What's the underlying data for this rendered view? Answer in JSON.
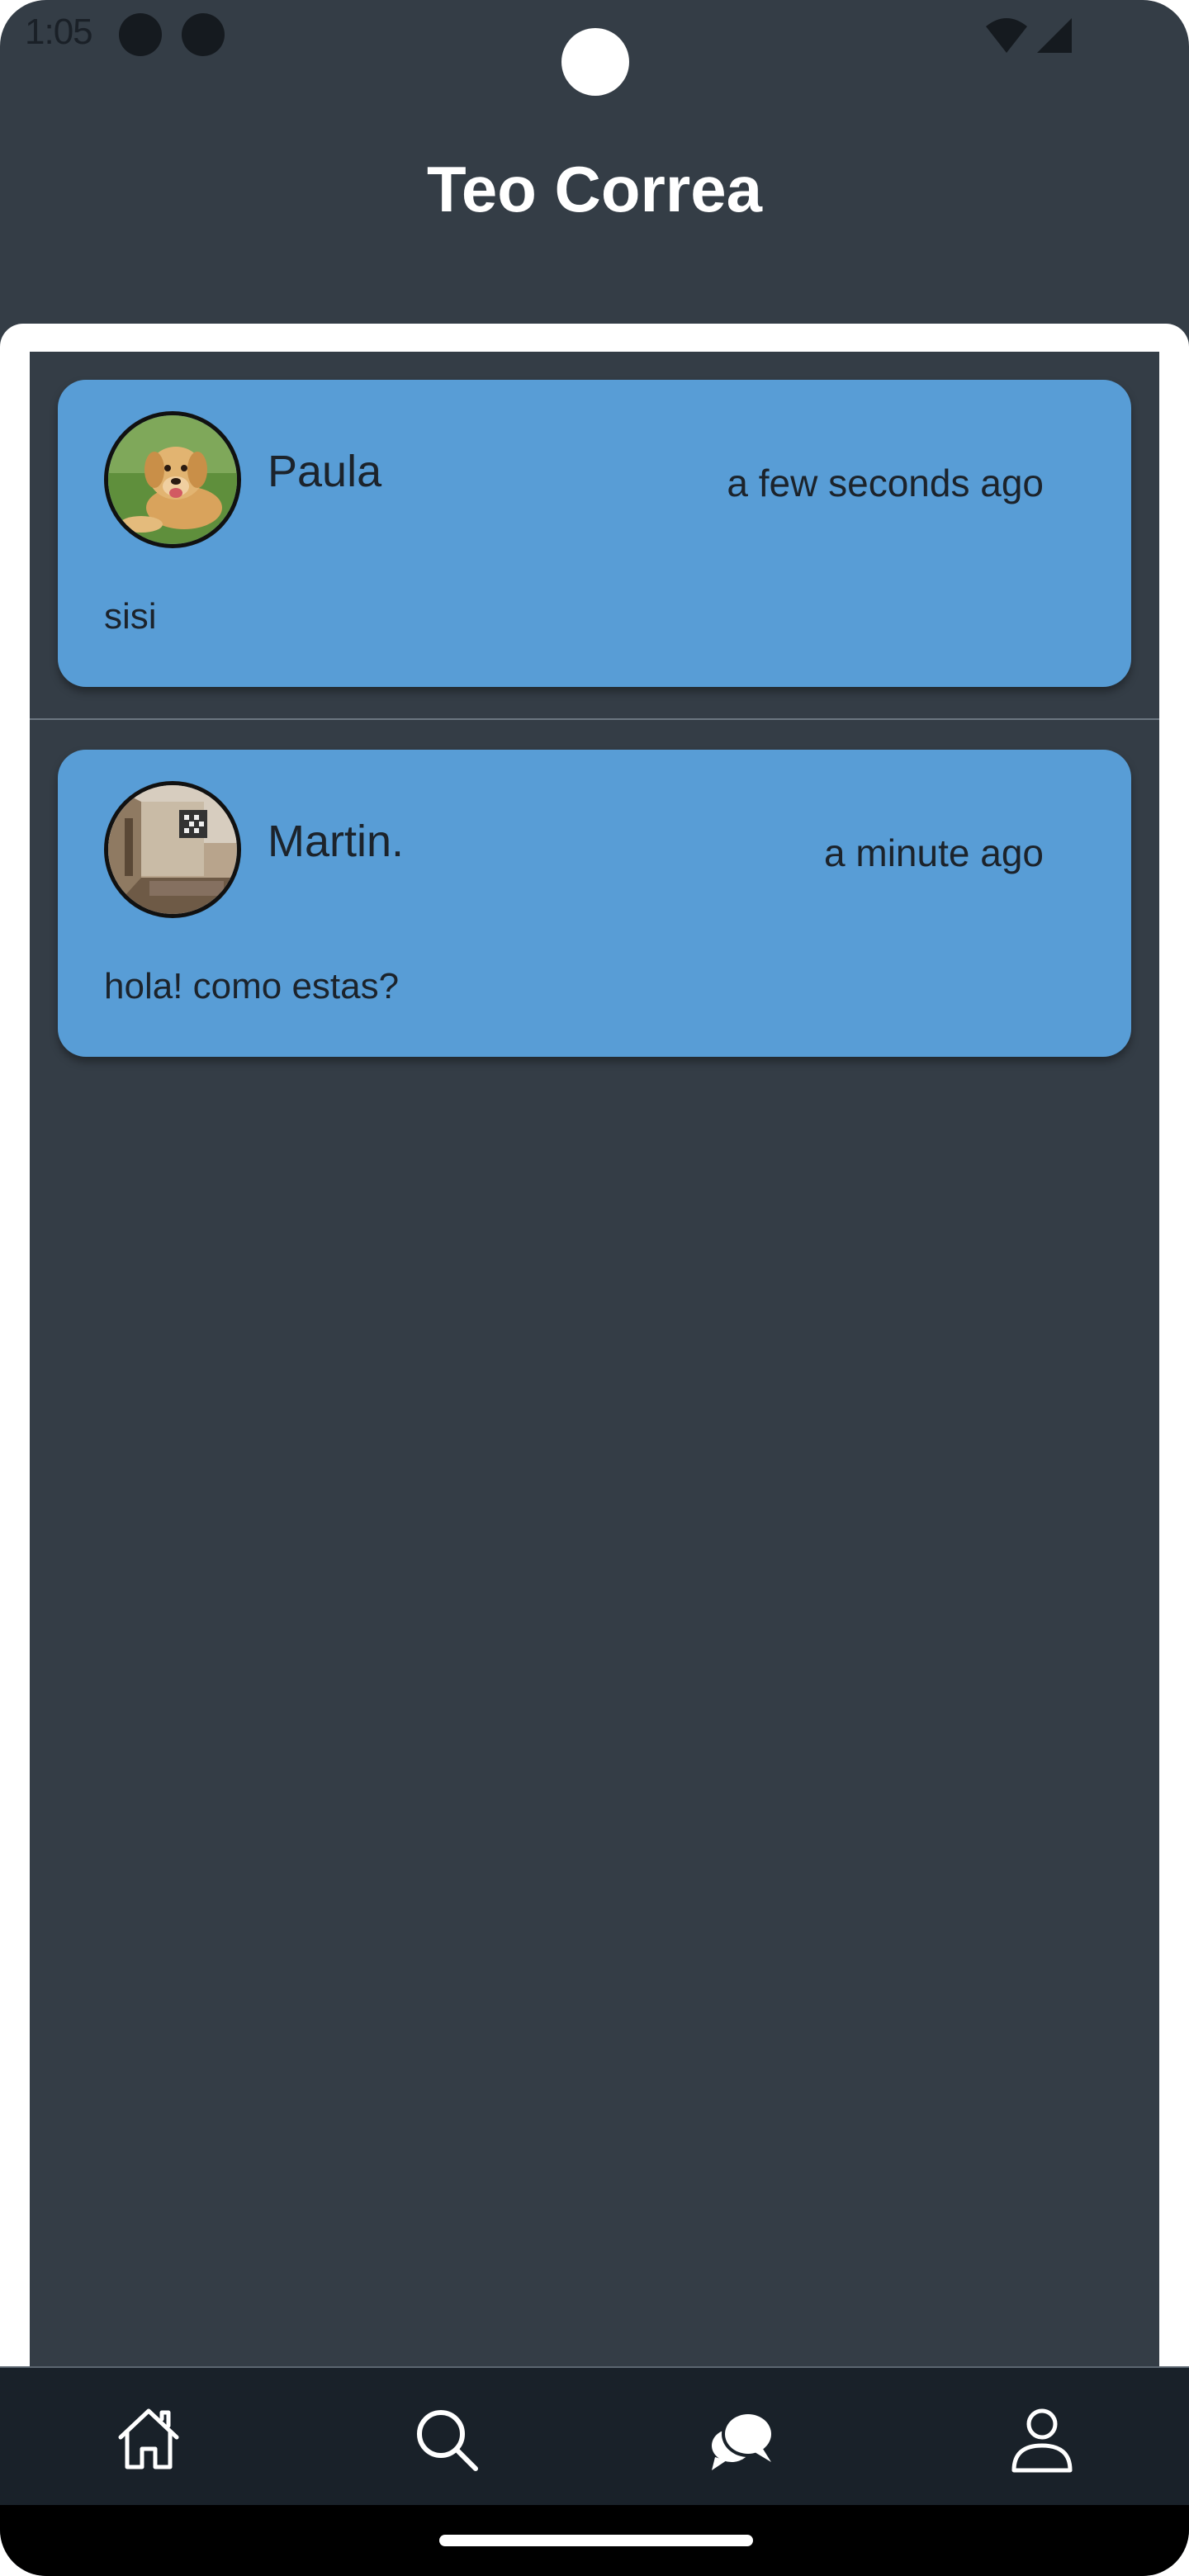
{
  "status_bar": {
    "time": "1:05"
  },
  "header": {
    "title": "Teo Correa"
  },
  "chats": [
    {
      "name": "Paula",
      "time": "a few seconds ago",
      "message": "sisi",
      "avatar": "dog-photo"
    },
    {
      "name": "Martin.",
      "time": "a minute ago",
      "message": "hola! como estas?",
      "avatar": "room-photo"
    }
  ],
  "bottom_nav": {
    "items": [
      {
        "icon": "home-icon"
      },
      {
        "icon": "search-icon"
      },
      {
        "icon": "chat-bubbles-icon",
        "active": true
      },
      {
        "icon": "profile-icon"
      }
    ]
  },
  "colors": {
    "background": "#343d46",
    "card": "#589dd6",
    "nav": "#192129",
    "text_dark": "#1c232b",
    "title": "#ffffff"
  }
}
